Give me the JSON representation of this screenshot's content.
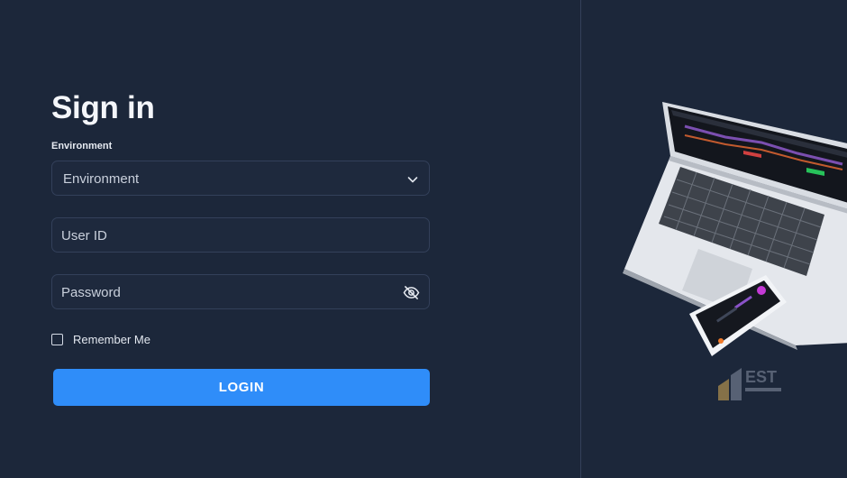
{
  "signin": {
    "title": "Sign in",
    "environment_label": "Environment",
    "environment_value": "Environment",
    "userid_placeholder": "User ID",
    "password_placeholder": "Password",
    "remember_label": "Remember Me",
    "login_label": "LOGIN"
  },
  "icons": {
    "dropdown": "chevron-down-icon",
    "password_toggle": "eye-off-icon"
  },
  "colors": {
    "background": "#1c273a",
    "accent": "#2f8df9"
  }
}
